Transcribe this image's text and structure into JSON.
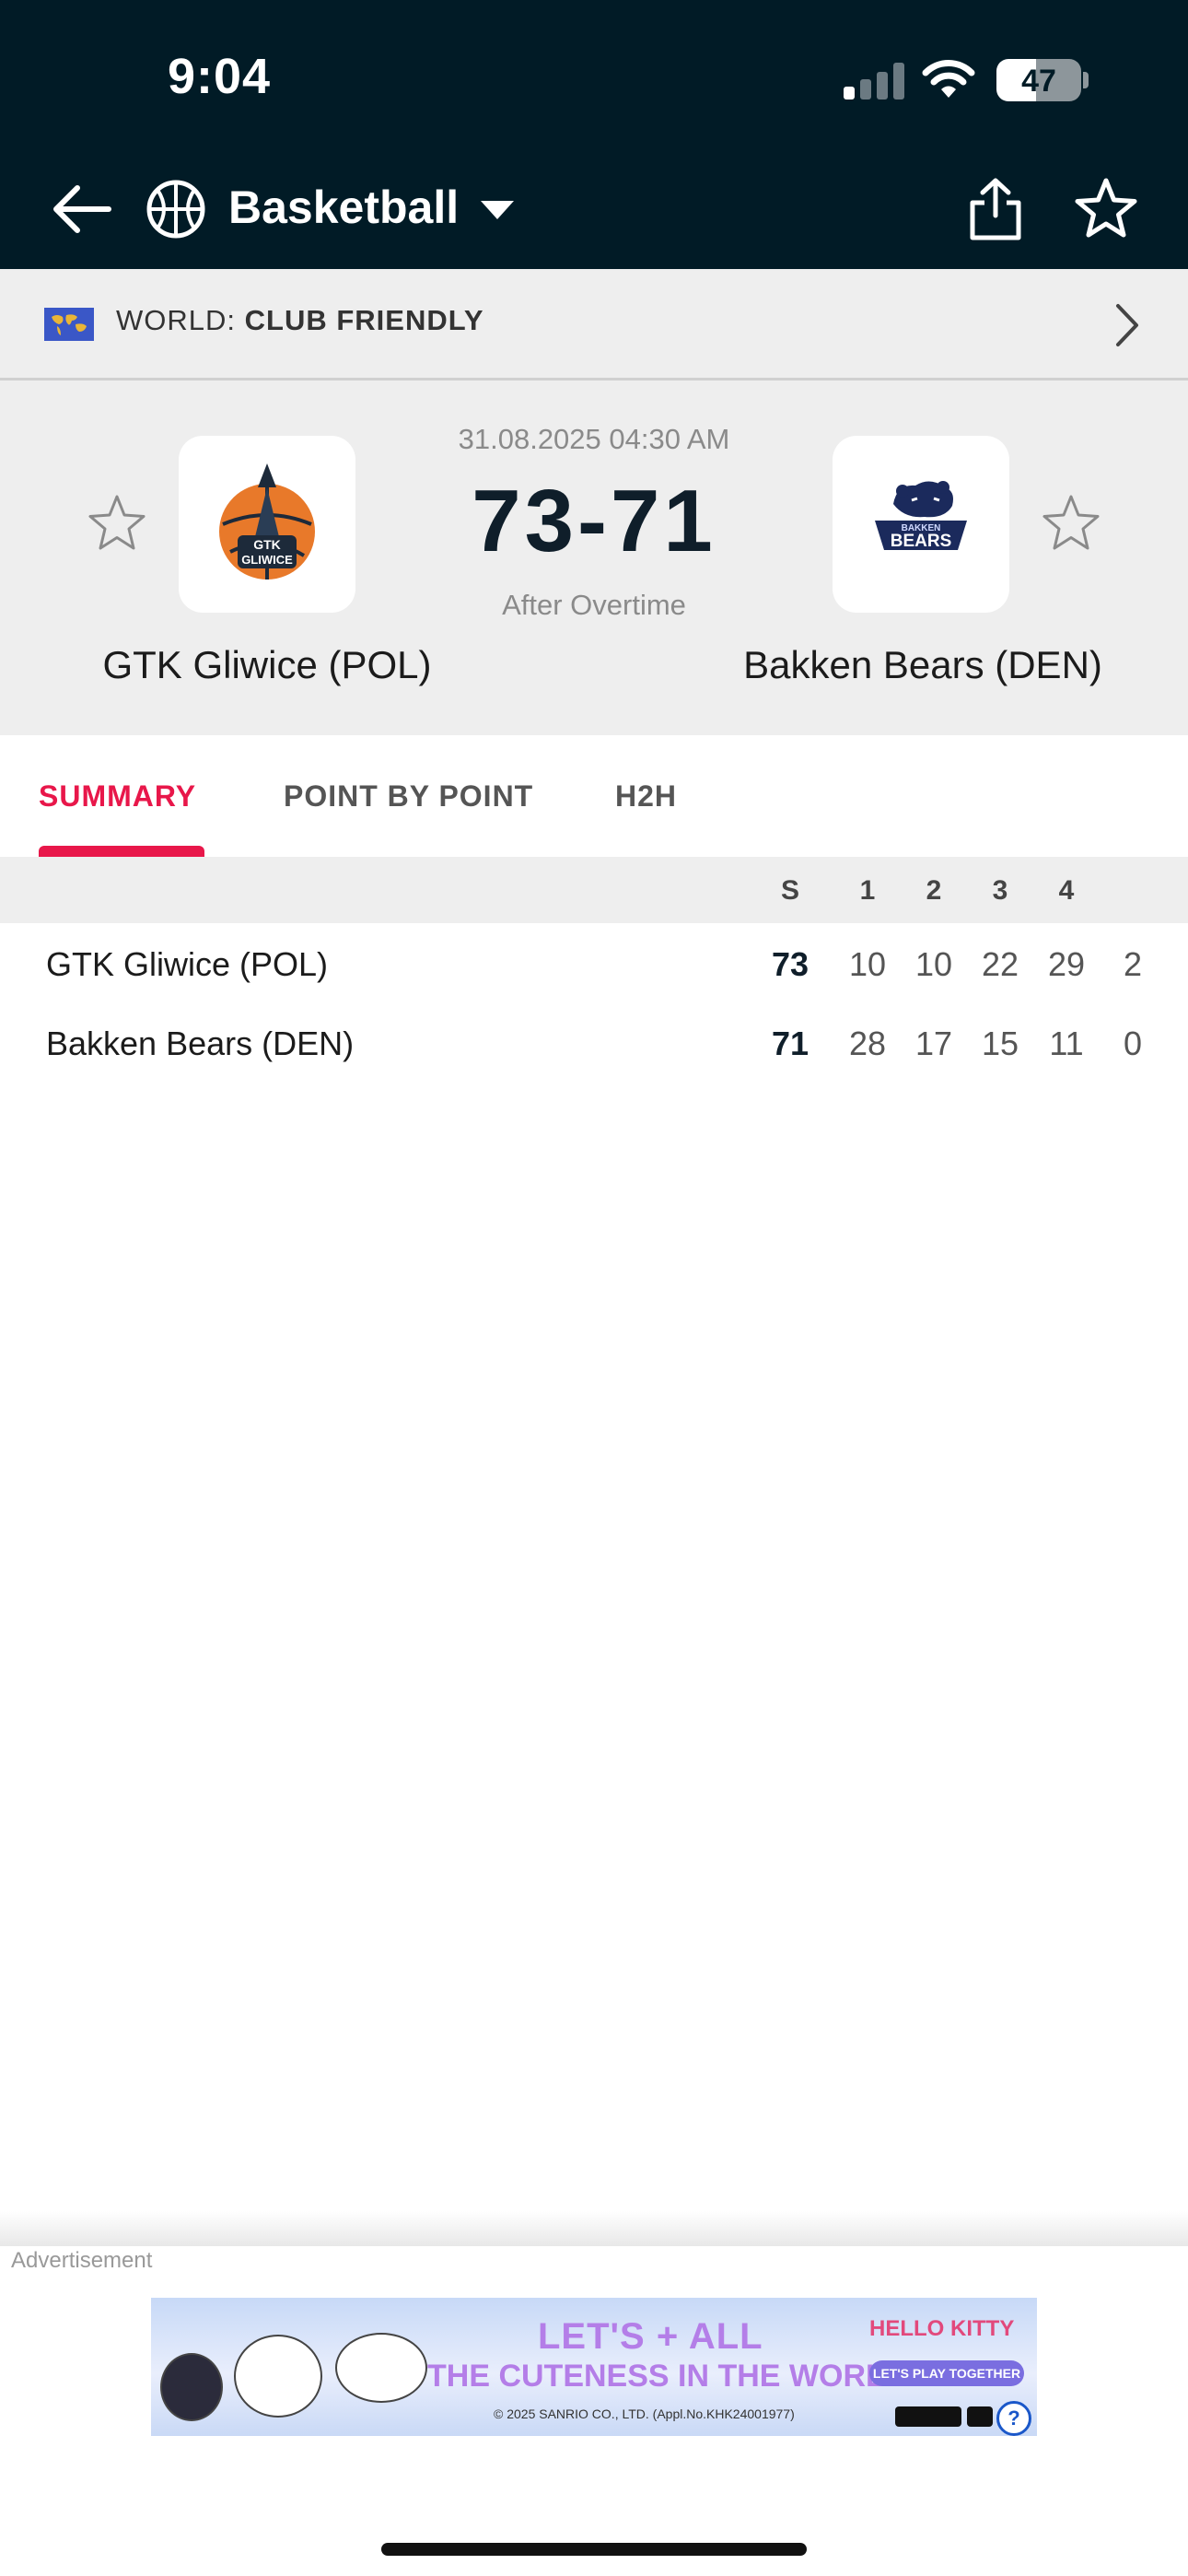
{
  "status_bar": {
    "time": "9:04",
    "battery": "47",
    "battery_level": 0.47,
    "signal_bars_active": 1
  },
  "nav": {
    "sport_title": "Basketball",
    "icons": [
      "back-arrow-icon",
      "basketball-icon",
      "dropdown-caret-icon",
      "share-icon",
      "star-icon"
    ]
  },
  "league": {
    "prefix": "WORLD: ",
    "name": "CLUB FRIENDLY",
    "icon": "world-flag-icon"
  },
  "match": {
    "datetime": "31.08.2025 04:30 AM",
    "score": "73-71",
    "status": "After Overtime",
    "home": {
      "name": "GTK Gliwice (POL)",
      "logo_text": "GTK GLIWICE"
    },
    "away": {
      "name": "Bakken Bears (DEN)",
      "logo_text": "BAKKEN BEARS"
    }
  },
  "tabs": [
    {
      "label": "SUMMARY",
      "active": true
    },
    {
      "label": "POINT BY POINT",
      "active": false
    },
    {
      "label": "H2H",
      "active": false
    }
  ],
  "score_table": {
    "headers": [
      "S",
      "1",
      "2",
      "3",
      "4"
    ],
    "rows": [
      {
        "team": "GTK Gliwice (POL)",
        "total": "73",
        "periods": [
          "10",
          "10",
          "22",
          "29",
          "2"
        ]
      },
      {
        "team": "Bakken Bears (DEN)",
        "total": "71",
        "periods": [
          "28",
          "17",
          "15",
          "11",
          "0"
        ]
      }
    ]
  },
  "ad": {
    "label": "Advertisement",
    "line1": "LET'S + ALL",
    "line2": "THE CUTENESS IN THE WORLD!",
    "brand": "HELLO KITTY",
    "cta": "LET'S PLAY TOGETHER",
    "copyright": "© 2025 SANRIO CO., LTD. (Appl.No.KHK24001977)",
    "help": "?"
  },
  "colors": {
    "header_bg": "#011b26",
    "accent": "#e8174a",
    "panel_bg": "#eeeeee"
  }
}
